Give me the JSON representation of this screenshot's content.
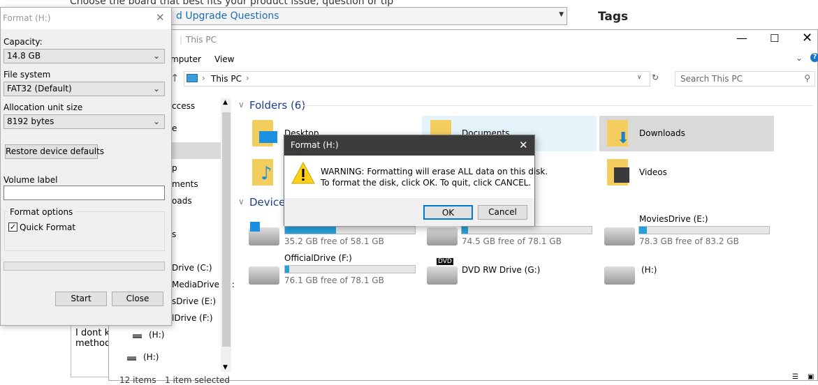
{
  "background_page": {
    "board_prompt": "Choose the board that best fits your product issue, question or tip",
    "board_select": "d Upgrade Questions",
    "tags_heading": "Tags",
    "post_lines": [
      "I dont kn",
      "methods"
    ]
  },
  "explorer": {
    "title": "This PC",
    "ribbon_tabs": [
      "mputer",
      "View"
    ],
    "address": "This PC",
    "search_placeholder": "Search This PC",
    "nav_items": [
      "ccess",
      "e",
      "p",
      "ments",
      "oads",
      "s",
      "Drive (C:)",
      "MediaDrive (D:",
      "sDrive (E:)",
      "lDrive (F:)",
      "(H:)",
      "(H:)"
    ],
    "folders_header": "Folders (6)",
    "folders": [
      "Desktop",
      "Documents",
      "Downloads",
      "Videos"
    ],
    "devices_header": "Devices",
    "drives": [
      {
        "label": "",
        "free": "35.2 GB free of 58.1 GB",
        "used_fraction": 0.39
      },
      {
        "label": ")",
        "free": "74.5 GB free of 78.1 GB",
        "used_fraction": 0.05
      },
      {
        "label": "MoviesDrive (E:)",
        "free": "78.3 GB free of 83.2 GB",
        "used_fraction": 0.06
      },
      {
        "label": "OfficialDrive (F:)",
        "free": "76.1 GB free of 78.1 GB",
        "used_fraction": 0.03
      },
      {
        "label": "DVD RW Drive (G:)",
        "dvd_badge": "DVD"
      },
      {
        "label": "(H:)"
      }
    ],
    "status_items": "12 items",
    "status_selected": "1 item selected"
  },
  "format_dialog": {
    "title": "Format  (H:)",
    "capacity_label": "Capacity:",
    "capacity": "14.8 GB",
    "fs_label": "File system",
    "fs": "FAT32 (Default)",
    "alloc_label": "Allocation unit size",
    "alloc": "8192 bytes",
    "restore": "Restore device defaults",
    "volume_label": "Volume label",
    "volume_value": "",
    "options_label": "Format options",
    "quick_format": "Quick Format",
    "quick_format_checked": true,
    "progress": 0,
    "start": "Start",
    "close": "Close"
  },
  "warning_dialog": {
    "title": "Format  (H:)",
    "line1": "WARNING: Formatting will erase ALL data on this disk.",
    "line2": "To format the disk, click OK. To quit, click CANCEL.",
    "ok": "OK",
    "cancel": "Cancel"
  },
  "colors": {
    "accent": "#26a0da",
    "selected_bg": "#d9d9d9",
    "hover_bg": "#e5f3fb",
    "dark_title": "#3c3c3c"
  }
}
